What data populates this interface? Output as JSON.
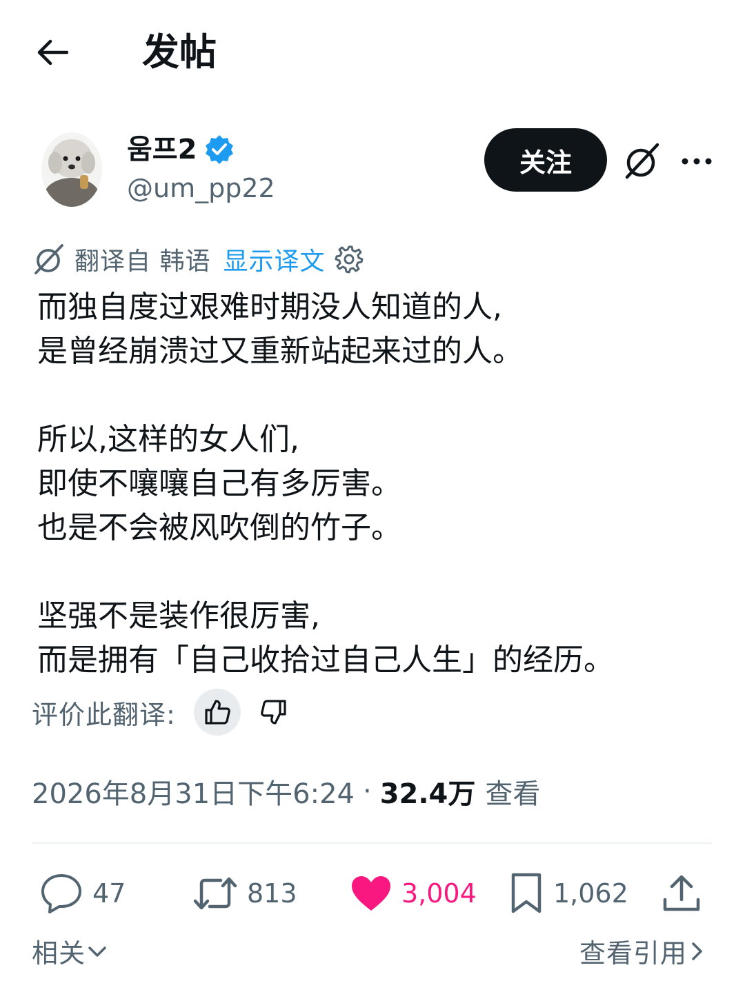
{
  "header": {
    "title": "发帖",
    "back_icon": "arrow-left-icon"
  },
  "author": {
    "display_name": "움프2",
    "handle": "@um_pp22",
    "verified": true,
    "verified_color": "#1d9bf0"
  },
  "follow_label": "关注",
  "translation": {
    "translated_from": "翻译自 韩语",
    "show_original": "显示译文",
    "rate_label": "评价此翻译:"
  },
  "post": {
    "paragraphs": [
      [
        "而独自度过艰难时期没人知道的人,",
        "是曾经崩溃过又重新站起来过的人。"
      ],
      [
        "所以,这样的女人们,",
        "即使不嚷嚷自己有多厉害。",
        "也是不会被风吹倒的竹子。"
      ],
      [
        "坚强不是装作很厉害,",
        "而是拥有「自己收拾过自己人生」的经历。"
      ]
    ]
  },
  "meta": {
    "timestamp": "2026年8月31日下午6:24",
    "separator": "·",
    "views_count": "32.4万",
    "views_label": "查看"
  },
  "actions": {
    "replies": "47",
    "reposts": "813",
    "likes": "3,004",
    "bookmarks": "1,062",
    "like_color": "#f91880"
  },
  "footer": {
    "related": "相关",
    "view_quotes": "查看引用"
  },
  "colors": {
    "text_primary": "#0f1419",
    "text_secondary": "#536471",
    "accent": "#1d9bf0"
  }
}
